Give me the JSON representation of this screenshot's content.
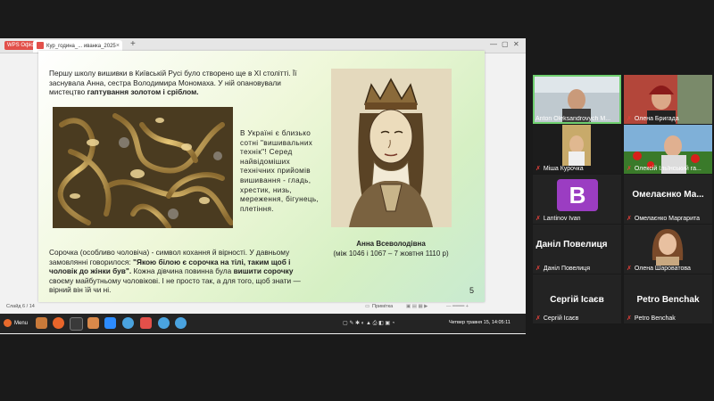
{
  "screen": {
    "app_badge": "WPS Офіс",
    "doc_tab": "Кур_година_... иванка_2025",
    "new_tab": "+",
    "win_min": "—",
    "win_max": "▢",
    "win_close": "✕"
  },
  "slide": {
    "p1_a": "Першу школу вишивки в Київській Русі було створено ще в ХІ столітті. Її заснувала Анна, сестра Володимира Мономаха. У ній опановували мистецтво ",
    "p1_b": "гаптування золотом і сріблом.",
    "p2": "В Україні є близько сотні \"вишивальних технік\"! Серед найвідоміших технічних прийомів вишивання - гладь, хрестик, низь, мереження, бігунець, плетіння.",
    "p3_a": "Сорочка (особливо чоловіча) - символ кохання й вірності. У давньому замовлянні говорилося: ",
    "p3_b": "\"Якою білою є сорочка на тілі, таким щоб і чоловік до жінки був\".",
    "p3_c": " Кожна дівчина повинна була ",
    "p3_d": "вишити сорочку",
    "p3_e": " своєму майбутньому чоловікові. І не просто так, а для того, щоб знати — вірний він їй чи ні.",
    "caption_name": "Анна Всеволодівна",
    "caption_dates": "(між 1046 і 1067 – 7 жовтня 1110 р)",
    "slide_number": "5"
  },
  "statusbar": {
    "slide_counter": "Слайд 6 / 14",
    "notes": "Примітка"
  },
  "taskbar": {
    "menu_label": "Menu",
    "clock": "Четвер травня 15, 14:05:11"
  },
  "participants": [
    {
      "name": "Anton Oleksandrovych M...",
      "type": "video",
      "active": true
    },
    {
      "name": "Олена Бригада",
      "type": "video"
    },
    {
      "name": "Міша Курочка",
      "type": "video"
    },
    {
      "name": "Олексій Ільїнський га...",
      "type": "video"
    },
    {
      "name": "Lantinov Ivan",
      "type": "avatar",
      "avatar_letter": "B"
    },
    {
      "name": "Омелаєнко Маргарита",
      "type": "name",
      "big": "Омелаєнко Ма..."
    },
    {
      "name": "Даніл Повелиця",
      "type": "name",
      "big": "Даніл Повелиця"
    },
    {
      "name": "Олена Шароватова",
      "type": "video"
    },
    {
      "name": "Сергій Ісаєв",
      "type": "name",
      "big": "Сергій Ісаєв"
    },
    {
      "name": "Petro Benchak",
      "type": "name",
      "big": "Petro Benchak"
    }
  ],
  "colors": {
    "accent_active": "#6fcf6f",
    "muted_mic": "#e0403a",
    "avatar_purple": "#9b3dc2"
  }
}
